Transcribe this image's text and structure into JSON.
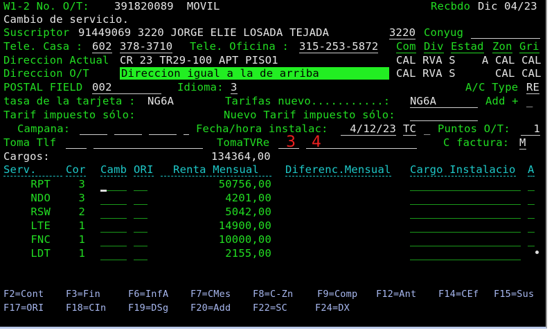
{
  "header": {
    "label": "W1-2 No. O/T:",
    "order_number": "391820089  MOVIL",
    "received_label": "Recbdo",
    "received_date": "Dic 04/23"
  },
  "subtitle": "Cambio de servicio.",
  "subscriber": {
    "label": "Suscriptor",
    "value": "91449069 3220 JORGE ELIE LOSADA TEJADA",
    "code": "3220",
    "spouse_label": "Conyug",
    "spouse_value": ""
  },
  "phones": {
    "home_label": "Tele. Casa :",
    "home_area": "602",
    "home_number": "378-3710",
    "office_label": "Tele. Oficina :",
    "office_number": "315-253-5872"
  },
  "geo_headers": [
    "Com",
    "Div",
    "Estad",
    "Zon",
    "Gri"
  ],
  "address_current": {
    "label": "Direccion Actual",
    "value": "CR 23 TR29-100 APT PISO1",
    "geo": "CAL RVA S    A CAL CAL"
  },
  "address_ot": {
    "label": "Direccion O/T",
    "value": "Direccion igual a la de arriba",
    "geo": "CAL RVA S      CAL CAL"
  },
  "postal": {
    "label": "POSTAL FIELD",
    "value": "002",
    "language_label": "Idioma:",
    "language_value": "3",
    "ac_type_label": "A/C Type",
    "ac_type_value": "RE"
  },
  "rates": {
    "card_rate_label": "tasa de la tarjeta :",
    "card_rate_value": "NG6A",
    "new_rates_label": "Tarifas nuevo...........:",
    "new_rates_value": "NG6A",
    "add_label": "Add +",
    "add_value": "_"
  },
  "tax": {
    "label": "Tarif impuesto sólo:",
    "new_label": "Nuevo Tarif impuesto sólo:",
    "new_value": ""
  },
  "campaign": {
    "label": "Campana:",
    "install_label": "Fecha/hora instalac:",
    "install_date": "4/12/23",
    "install_time": "TC",
    "install_extra": "_",
    "points_label": "Puntos O/T:",
    "points_value": "1"
  },
  "toma": {
    "tlf_label": "Toma Tlf",
    "tv_label": "TomaTVRe",
    "annotation_1": "3",
    "annotation_2": "4",
    "billing_label": "C factura:",
    "billing_value": "M"
  },
  "charges": {
    "label": "Cargos:",
    "value": "134364,00"
  },
  "table": {
    "headers": [
      "Serv.",
      "Cor",
      "Camb",
      "ORI",
      "Renta Mensual",
      "Diferenc.Mensual",
      "Cargo Instalacio",
      "A"
    ],
    "rows": [
      {
        "serv": "RPT",
        "cor": "3",
        "renta": "50756,00"
      },
      {
        "serv": "NDO",
        "cor": "3",
        "renta": "4201,00"
      },
      {
        "serv": "RSW",
        "cor": "2",
        "renta": "5042,00"
      },
      {
        "serv": "LTE",
        "cor": "1",
        "renta": "14900,00"
      },
      {
        "serv": "FNC",
        "cor": "1",
        "renta": "10000,00"
      },
      {
        "serv": "LDT",
        "cor": "1",
        "renta": "2155,00"
      }
    ]
  },
  "function_keys": [
    [
      "F2=Cont",
      "F3=Fin",
      "F6=InfA",
      "F7=CMes",
      "F8=C-Zn",
      "F9=Comp",
      "F12=Ant",
      "F14=CEf",
      "F15=Sus"
    ],
    [
      "F17=ORI",
      "F18=CIn",
      "F19=DSg",
      "F20=Add",
      "F22=SC",
      "F24=DX"
    ]
  ],
  "colors": {
    "label": "#22dd22",
    "value": "#e6e6e6",
    "header": "#1ec8c8",
    "highlight": "#22ee22",
    "annotation": "#ee2020",
    "function_keys": "#a8b8f0"
  }
}
